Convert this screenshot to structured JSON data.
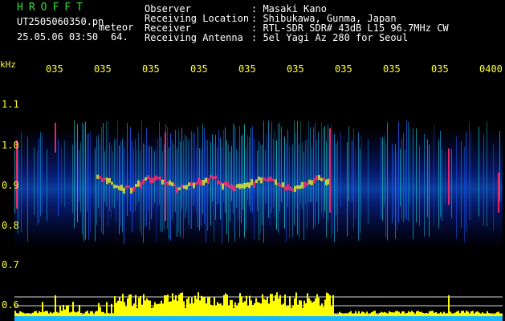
{
  "header": {
    "app_name": "HROFFT",
    "filename": "UT2505060350.pn",
    "tag": "meteor",
    "datetime": "25.05.06 03:50",
    "value": "64.",
    "fields": [
      {
        "label": "Observer",
        "value": ": Masaki Kano"
      },
      {
        "label": "Receiving Location",
        "value": ": Shibukawa, Gunma, Japan"
      },
      {
        "label": "Receiver",
        "value": ": RTL-SDR SDR# 43dB L15 96.7MHz CW"
      },
      {
        "label": "Receiving Antenna",
        "value": ": 5el Yagi Az 280 for Seoul"
      }
    ]
  },
  "y_axis": {
    "unit": "kHz",
    "ticks": [
      "1.1",
      "1.0",
      "0.9",
      "0.8",
      "0.7",
      "0.6"
    ]
  },
  "x_axis": {
    "ticks": [
      "035",
      "035",
      "035",
      "035",
      "035",
      "035",
      "035",
      "035",
      "035",
      "0400"
    ]
  },
  "colors": {
    "background": "#000000",
    "header_text": "#ffffff",
    "app_name": "#2fe02f",
    "axis_labels": "#ffff33",
    "spectrum_low": "#0a1a8c",
    "spectrum_mid": "#18c8c8",
    "spectrum_high": "#ff2a6a",
    "amplitude_bars": "#ffff00"
  }
}
